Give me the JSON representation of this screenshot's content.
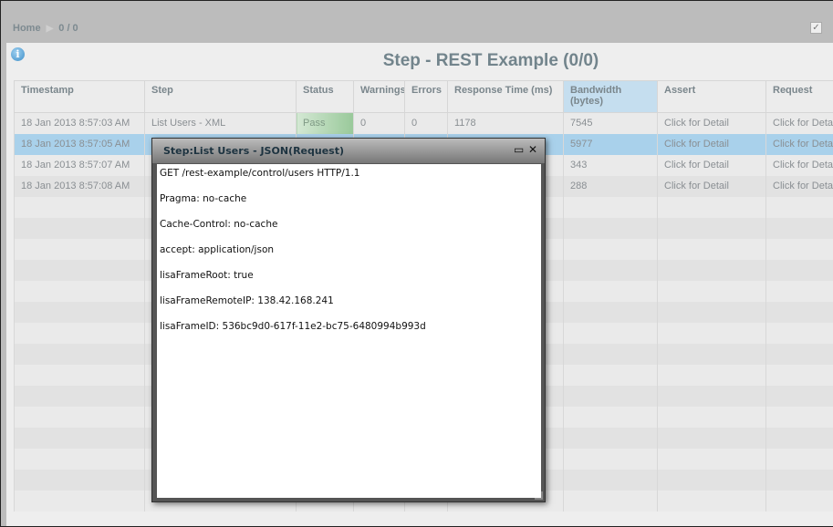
{
  "breadcrumb": {
    "home": "Home",
    "position": "0 / 0"
  },
  "page_title": "Step - REST Example (0/0)",
  "table": {
    "columns": [
      "Timestamp",
      "Step",
      "Status",
      "Warnings",
      "Errors",
      "Response Time (ms)",
      "Bandwidth (bytes)",
      "Assert",
      "Request"
    ],
    "rows": [
      {
        "timestamp": "18 Jan 2013 8:57:03 AM",
        "step": "List Users - XML",
        "status": "Pass",
        "warnings": "0",
        "errors": "0",
        "response_time": "1178",
        "bandwidth": "7545",
        "assert": "Click for Detail",
        "request": "Click for Detail"
      },
      {
        "timestamp": "18 Jan 2013 8:57:05 AM",
        "step": "",
        "status": "",
        "warnings": "",
        "errors": "",
        "response_time": "",
        "bandwidth": "5977",
        "assert": "Click for Detail",
        "request": "Click for Detail"
      },
      {
        "timestamp": "18 Jan 2013 8:57:07 AM",
        "step": "",
        "status": "",
        "warnings": "",
        "errors": "",
        "response_time": "",
        "bandwidth": "343",
        "assert": "Click for Detail",
        "request": "Click for Detail"
      },
      {
        "timestamp": "18 Jan 2013 8:57:08 AM",
        "step": "",
        "status": "",
        "warnings": "",
        "errors": "",
        "response_time": "",
        "bandwidth": "288",
        "assert": "Click for Detail",
        "request": "Click for Detail"
      }
    ]
  },
  "modal": {
    "title": "Step:List Users - JSON(Request)",
    "lines": [
      "GET /rest-example/control/users HTTP/1.1",
      "Pragma: no-cache",
      "Cache-Control: no-cache",
      "accept: application/json",
      "lisaFrameRoot: true",
      "lisaFrameRemoteIP: 138.42.168.241",
      "lisaFrameID: 536bc9d0-617f-11e2-bc75-6480994b993d"
    ]
  }
}
